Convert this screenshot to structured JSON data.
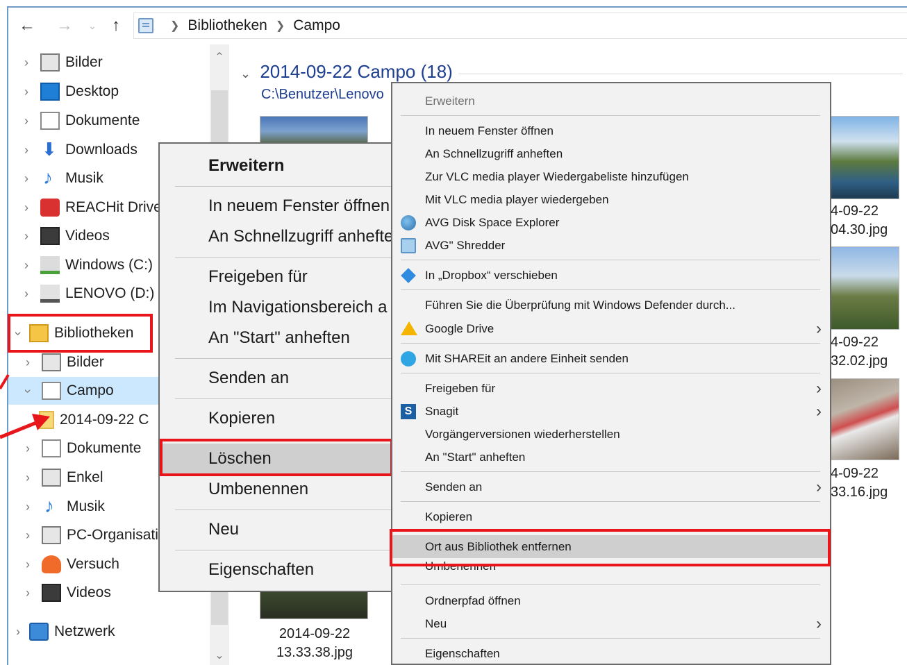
{
  "address": {
    "segments": [
      "Bibliotheken",
      "Campo"
    ]
  },
  "nav_pane": {
    "items": [
      {
        "label": "Bilder",
        "icon": "pictures-icon"
      },
      {
        "label": "Desktop",
        "icon": "desktop-icon"
      },
      {
        "label": "Dokumente",
        "icon": "documents-icon"
      },
      {
        "label": "Downloads",
        "icon": "downloads-icon"
      },
      {
        "label": "Musik",
        "icon": "music-icon"
      },
      {
        "label": "REACHit Drive",
        "icon": "reachit-icon"
      },
      {
        "label": "Videos",
        "icon": "videos-icon"
      },
      {
        "label": "Windows (C:)",
        "icon": "drive-c-icon"
      },
      {
        "label": "LENOVO (D:)",
        "icon": "drive-d-icon"
      },
      {
        "label": "Bibliotheken",
        "icon": "libraries-icon"
      },
      {
        "label": "Bilder",
        "icon": "pictures-library-icon"
      },
      {
        "label": "Campo",
        "icon": "campo-library-icon"
      },
      {
        "label": "2014-09-22 C",
        "icon": "folder-icon"
      },
      {
        "label": "Dokumente",
        "icon": "documents-library-icon"
      },
      {
        "label": "Enkel",
        "icon": "enkel-library-icon"
      },
      {
        "label": "Musik",
        "icon": "music-library-icon"
      },
      {
        "label": "PC-Organisati",
        "icon": "pc-organisation-icon"
      },
      {
        "label": "Versuch",
        "icon": "versuch-icon"
      },
      {
        "label": "Videos",
        "icon": "videos-library-icon"
      },
      {
        "label": "Netzwerk",
        "icon": "network-icon"
      }
    ]
  },
  "content": {
    "group_title": "2014-09-22 Campo (18)",
    "group_path": "C:\\Benutzer\\Lenovo",
    "files": [
      {
        "line1": "4-09-22",
        "line2": "04.30.jpg"
      },
      {
        "line1": "4-09-22",
        "line2": "32.02.jpg"
      },
      {
        "line1": "4-09-22",
        "line2": "33.16.jpg"
      },
      {
        "line1": "2014-09-22",
        "line2": "13.33.38.jpg"
      }
    ]
  },
  "menu1": {
    "items": [
      "Erweitern",
      "In neuem Fenster öffnen",
      "An Schnellzugriff anheften",
      "Freigeben für",
      "Im Navigationsbereich a",
      "An \"Start\" anheften",
      "Senden an",
      "Kopieren",
      "Löschen",
      "Umbenennen",
      "Neu",
      "Eigenschaften"
    ]
  },
  "menu2": {
    "items": [
      "Erweitern",
      "In neuem Fenster öffnen",
      "An Schnellzugriff anheften",
      "Zur VLC media player Wiedergabeliste hinzufügen",
      "Mit VLC media player wiedergeben",
      "AVG Disk Space Explorer",
      "AVG\" Shredder",
      "In „Dropbox“ verschieben",
      "Führen Sie die Überprüfung mit Windows Defender durch...",
      "Google Drive",
      "Mit SHAREit an andere Einheit senden",
      "Freigeben für",
      "Snagit",
      "Vorgängerversionen wiederherstellen",
      "An \"Start\" anheften",
      "Senden an",
      "Kopieren",
      "Ort aus Bibliothek entfernen",
      "Umbenennen",
      "Ordnerpfad öffnen",
      "Neu",
      "Eigenschaften"
    ]
  },
  "colors": {
    "highlight_red": "#e8151b",
    "selection_blue": "#cce8ff",
    "group_title_blue": "#1e3e90"
  }
}
